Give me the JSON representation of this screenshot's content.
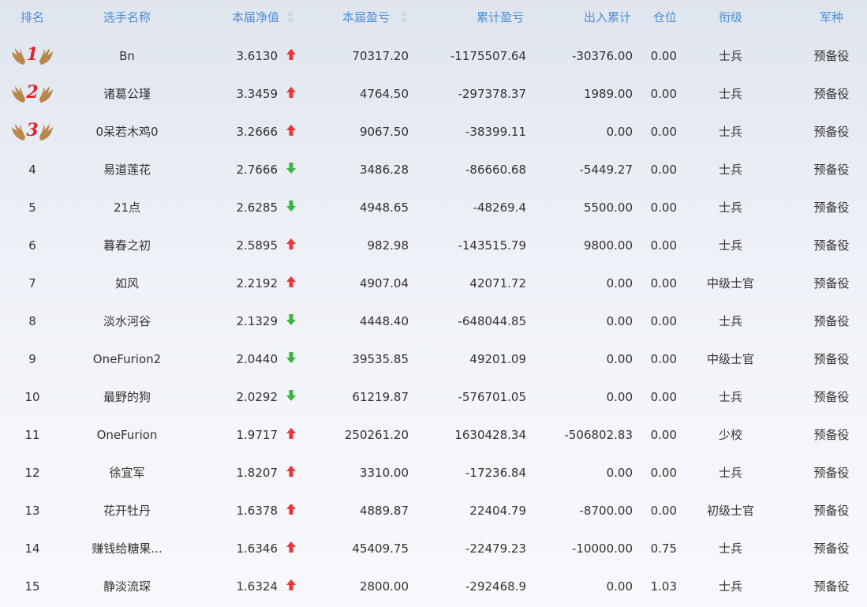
{
  "colors": {
    "header_text": "#4a8fd8",
    "up_arrow": "#e8353e",
    "down_arrow": "#35b542",
    "medal_number": "#e0242d",
    "medal_wing": "#b9874a"
  },
  "headers": {
    "rank": "排名",
    "name": "选手名称",
    "net_value": "本届净值",
    "profit": "本届盈亏",
    "cumulative": "累计盈亏",
    "in_out": "出入累计",
    "position": "仓位",
    "title": "衔级",
    "branch": "军种"
  },
  "rows": [
    {
      "rank": "1",
      "medal": "wing-medal-icon",
      "name": "Bn",
      "net": "3.6130",
      "trend": "up",
      "profit": "70317.20",
      "cum": "-1175507.64",
      "flow": "-30376.00",
      "pos": "0.00",
      "title": "士兵",
      "branch": "预备役"
    },
    {
      "rank": "2",
      "medal": "wing-medal-icon",
      "name": "诸葛公瑾",
      "net": "3.3459",
      "trend": "up",
      "profit": "4764.50",
      "cum": "-297378.37",
      "flow": "1989.00",
      "pos": "0.00",
      "title": "士兵",
      "branch": "预备役"
    },
    {
      "rank": "3",
      "medal": "wing-medal-icon",
      "name": "0呆若木鸡0",
      "net": "3.2666",
      "trend": "up",
      "profit": "9067.50",
      "cum": "-38399.11",
      "flow": "0.00",
      "pos": "0.00",
      "title": "士兵",
      "branch": "预备役"
    },
    {
      "rank": "4",
      "name": "易道莲花",
      "net": "2.7666",
      "trend": "down",
      "profit": "3486.28",
      "cum": "-86660.68",
      "flow": "-5449.27",
      "pos": "0.00",
      "title": "士兵",
      "branch": "预备役"
    },
    {
      "rank": "5",
      "name": "21点",
      "net": "2.6285",
      "trend": "down",
      "profit": "4948.65",
      "cum": "-48269.4",
      "flow": "5500.00",
      "pos": "0.00",
      "title": "士兵",
      "branch": "预备役"
    },
    {
      "rank": "6",
      "name": "暮春之初",
      "net": "2.5895",
      "trend": "up",
      "profit": "982.98",
      "cum": "-143515.79",
      "flow": "9800.00",
      "pos": "0.00",
      "title": "士兵",
      "branch": "预备役"
    },
    {
      "rank": "7",
      "name": "如风",
      "net": "2.2192",
      "trend": "up",
      "profit": "4907.04",
      "cum": "42071.72",
      "flow": "0.00",
      "pos": "0.00",
      "title": "中级士官",
      "branch": "预备役"
    },
    {
      "rank": "8",
      "name": "淡水河谷",
      "net": "2.1329",
      "trend": "down",
      "profit": "4448.40",
      "cum": "-648044.85",
      "flow": "0.00",
      "pos": "0.00",
      "title": "士兵",
      "branch": "预备役"
    },
    {
      "rank": "9",
      "name": "OneFurion2",
      "net": "2.0440",
      "trend": "down",
      "profit": "39535.85",
      "cum": "49201.09",
      "flow": "0.00",
      "pos": "0.00",
      "title": "中级士官",
      "branch": "预备役"
    },
    {
      "rank": "10",
      "name": "最野的狗",
      "net": "2.0292",
      "trend": "down",
      "profit": "61219.87",
      "cum": "-576701.05",
      "flow": "0.00",
      "pos": "0.00",
      "title": "士兵",
      "branch": "预备役"
    },
    {
      "rank": "11",
      "name": "OneFurion",
      "net": "1.9717",
      "trend": "up",
      "profit": "250261.20",
      "cum": "1630428.34",
      "flow": "-506802.83",
      "pos": "0.00",
      "title": "少校",
      "branch": "预备役"
    },
    {
      "rank": "12",
      "name": "徐宜军",
      "net": "1.8207",
      "trend": "up",
      "profit": "3310.00",
      "cum": "-17236.84",
      "flow": "0.00",
      "pos": "0.00",
      "title": "士兵",
      "branch": "预备役"
    },
    {
      "rank": "13",
      "name": "花开牡丹",
      "net": "1.6378",
      "trend": "up",
      "profit": "4889.87",
      "cum": "22404.79",
      "flow": "-8700.00",
      "pos": "0.00",
      "title": "初级士官",
      "branch": "预备役"
    },
    {
      "rank": "14",
      "name": "赚钱给糖果...",
      "net": "1.6346",
      "trend": "up",
      "profit": "45409.75",
      "cum": "-22479.23",
      "flow": "-10000.00",
      "pos": "0.75",
      "title": "士兵",
      "branch": "预备役"
    },
    {
      "rank": "15",
      "name": "静淡流琛",
      "net": "1.6324",
      "trend": "up",
      "profit": "2800.00",
      "cum": "-292468.9",
      "flow": "0.00",
      "pos": "1.03",
      "title": "士兵",
      "branch": "预备役"
    }
  ]
}
